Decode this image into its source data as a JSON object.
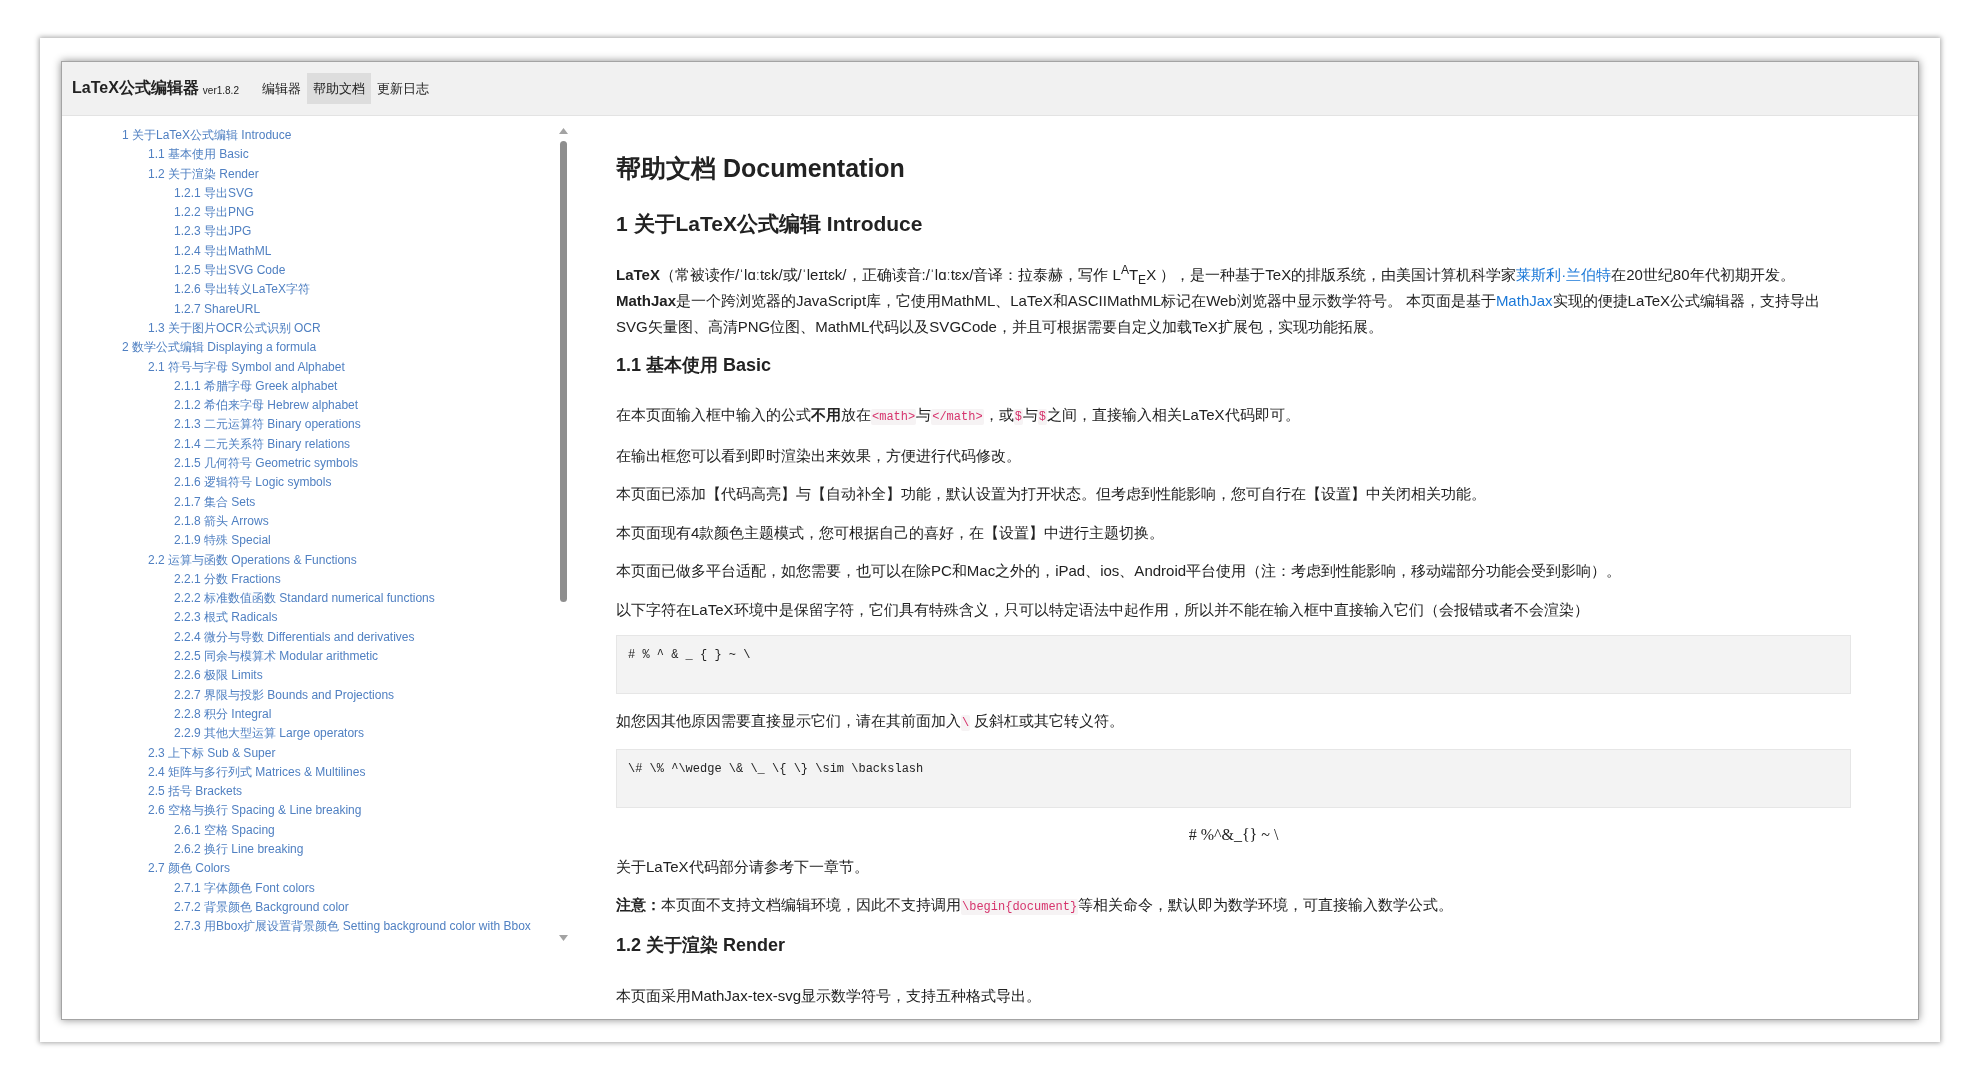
{
  "window": {
    "app_title": "LaTeX公式编辑器",
    "version": "ver1.8.2"
  },
  "nav": {
    "tabs": [
      {
        "label": "编辑器",
        "selected": false
      },
      {
        "label": "帮助文档",
        "selected": true
      },
      {
        "label": "更新日志",
        "selected": false
      }
    ]
  },
  "sidebar": {
    "toc": [
      {
        "label": "1 关于LaTeX公式编辑 Introduce",
        "children": [
          {
            "label": "1.1 基本使用 Basic"
          },
          {
            "label": "1.2 关于渲染 Render",
            "children": [
              {
                "label": "1.2.1 导出SVG"
              },
              {
                "label": "1.2.2 导出PNG"
              },
              {
                "label": "1.2.3 导出JPG"
              },
              {
                "label": "1.2.4 导出MathML"
              },
              {
                "label": "1.2.5 导出SVG Code"
              },
              {
                "label": "1.2.6 导出转义LaTeX字符"
              },
              {
                "label": "1.2.7 ShareURL"
              }
            ]
          },
          {
            "label": "1.3 关于图片OCR公式识别 OCR"
          }
        ]
      },
      {
        "label": "2 数学公式编辑 Displaying a formula",
        "children": [
          {
            "label": "2.1 符号与字母 Symbol and Alphabet",
            "children": [
              {
                "label": "2.1.1 希腊字母 Greek alphabet"
              },
              {
                "label": "2.1.2 希伯来字母 Hebrew alphabet"
              },
              {
                "label": "2.1.3 二元运算符 Binary operations"
              },
              {
                "label": "2.1.4 二元关系符 Binary relations"
              },
              {
                "label": "2.1.5 几何符号 Geometric symbols"
              },
              {
                "label": "2.1.6 逻辑符号 Logic symbols"
              },
              {
                "label": "2.1.7 集合 Sets"
              },
              {
                "label": "2.1.8 箭头 Arrows"
              },
              {
                "label": "2.1.9 特殊 Special"
              }
            ]
          },
          {
            "label": "2.2 运算与函数 Operations & Functions",
            "children": [
              {
                "label": "2.2.1 分数 Fractions"
              },
              {
                "label": "2.2.2 标准数值函数 Standard numerical functions"
              },
              {
                "label": "2.2.3 根式 Radicals"
              },
              {
                "label": "2.2.4 微分与导数 Differentials and derivatives"
              },
              {
                "label": "2.2.5 同余与模算术 Modular arithmetic"
              },
              {
                "label": "2.2.6 极限 Limits"
              },
              {
                "label": "2.2.7 界限与投影 Bounds and Projections"
              },
              {
                "label": "2.2.8 积分 Integral"
              },
              {
                "label": "2.2.9 其他大型运算 Large operators"
              }
            ]
          },
          {
            "label": "2.3 上下标 Sub & Super"
          },
          {
            "label": "2.4 矩阵与多行列式 Matrices & Multilines"
          },
          {
            "label": "2.5 括号 Brackets"
          },
          {
            "label": "2.6 空格与换行 Spacing & Line breaking",
            "children": [
              {
                "label": "2.6.1 空格 Spacing"
              },
              {
                "label": "2.6.2 换行 Line breaking"
              }
            ]
          },
          {
            "label": "2.7 颜色 Colors",
            "children": [
              {
                "label": "2.7.1 字体颜色 Font colors"
              },
              {
                "label": "2.7.2 背景颜色 Background color"
              },
              {
                "label": "2.7.3 用Bbox扩展设置背景颜色 Setting background color with Bbox"
              }
            ]
          }
        ]
      }
    ]
  },
  "content": {
    "blocks": [
      {
        "kind": "h1",
        "text": "帮助文档 Documentation"
      },
      {
        "kind": "h2",
        "text": "1 关于LaTeX公式编辑 Introduce"
      },
      {
        "kind": "p",
        "segments": [
          {
            "kind": "text",
            "text": "**LaTeX**（常被读作/ˈlɑːtɛk/或/ˈleɪtɛk/，正确读音:/ˈlɑːtɛx/音译：拉泰赫，写作 L$^{A}$T$_{E}$X ），是一种基于TeX的排版系统，由美国计算机科学家"
          },
          {
            "kind": "link",
            "text": "莱斯利·兰伯特"
          },
          {
            "kind": "text",
            "text": "在20世纪80年代初期开发。 **MathJax**是一个跨浏览器的JavaScript库，它使用MathML、LaTeX和ASCIIMathML标记在Web浏览器中显示数学符号。 本页面是基于"
          },
          {
            "kind": "link",
            "text": "MathJax"
          },
          {
            "kind": "text",
            "text": "实现的便捷LaTeX公式编辑器，支持导出SVG矢量图、高清PNG位图、MathML代码以及SVGCode，并且可根据需要自定义加载TeX扩展包，实现功能拓展。"
          }
        ]
      },
      {
        "kind": "h3",
        "text": "1.1 基本使用 Basic"
      },
      {
        "kind": "p",
        "segments": [
          {
            "kind": "text",
            "text": "在本页面输入框中输入的公式**不用**放在"
          },
          {
            "kind": "code",
            "text": "<math>"
          },
          {
            "kind": "text",
            "text": "与"
          },
          {
            "kind": "code",
            "text": "</math>"
          },
          {
            "kind": "text",
            "text": "，或"
          },
          {
            "kind": "code",
            "text": "$"
          },
          {
            "kind": "text",
            "text": "与"
          },
          {
            "kind": "code",
            "text": "$"
          },
          {
            "kind": "text",
            "text": "之间，直接输入相关LaTeX代码即可。"
          }
        ]
      },
      {
        "kind": "p",
        "segments": [
          {
            "kind": "text",
            "text": "在输出框您可以看到即时渲染出来效果，方便进行代码修改。"
          }
        ]
      },
      {
        "kind": "p",
        "segments": [
          {
            "kind": "text",
            "text": "本页面已添加【代码高亮】与【自动补全】功能，默认设置为打开状态。但考虑到性能影响，您可自行在【设置】中关闭相关功能。"
          }
        ]
      },
      {
        "kind": "p",
        "segments": [
          {
            "kind": "text",
            "text": "本页面现有4款颜色主题模式，您可根据自己的喜好，在【设置】中进行主题切换。"
          }
        ]
      },
      {
        "kind": "p",
        "segments": [
          {
            "kind": "text",
            "text": "本页面已做多平台适配，如您需要，也可以在除PC和Mac之外的，iPad、ios、Android平台使用（注：考虑到性能影响，移动端部分功能会受到影响）。"
          }
        ]
      },
      {
        "kind": "p",
        "segments": [
          {
            "kind": "text",
            "text": "以下字符在LaTeX环境中是保留字符，它们具有特殊含义，只可以特定语法中起作用，所以并不能在输入框中直接输入它们（会报错或者不会渲染）"
          }
        ]
      },
      {
        "kind": "code",
        "text": "# % ^ & _ { } ~ \\"
      },
      {
        "kind": "p",
        "segments": [
          {
            "kind": "text",
            "text": "如您因其他原因需要直接显示它们，请在其前面加入"
          },
          {
            "kind": "code",
            "text": "\\"
          },
          {
            "kind": "text",
            "text": " 反斜杠或其它转义符。"
          }
        ]
      },
      {
        "kind": "code",
        "text": "\\# \\% ^\\wedge \\& \\_ \\{ \\} \\sim \\backslash"
      },
      {
        "kind": "math",
        "text": "# %^&_{} ~ \\"
      },
      {
        "kind": "p",
        "segments": [
          {
            "kind": "text",
            "text": "关于LaTeX代码部分请参考下一章节。"
          }
        ]
      },
      {
        "kind": "p",
        "segments": [
          {
            "kind": "text",
            "text": "**注意：**本页面不支持文档编辑环境，因此不支持调用"
          },
          {
            "kind": "code",
            "text": "\\begin{document}"
          },
          {
            "kind": "text",
            "text": "等相关命令，默认即为数学环境，可直接输入数学公式。"
          }
        ]
      },
      {
        "kind": "h3",
        "text": "1.2 关于渲染 Render"
      },
      {
        "kind": "p",
        "segments": [
          {
            "kind": "text",
            "text": "本页面采用MathJax-tex-svg显示数学符号，支持五种格式导出。"
          }
        ]
      }
    ]
  }
}
